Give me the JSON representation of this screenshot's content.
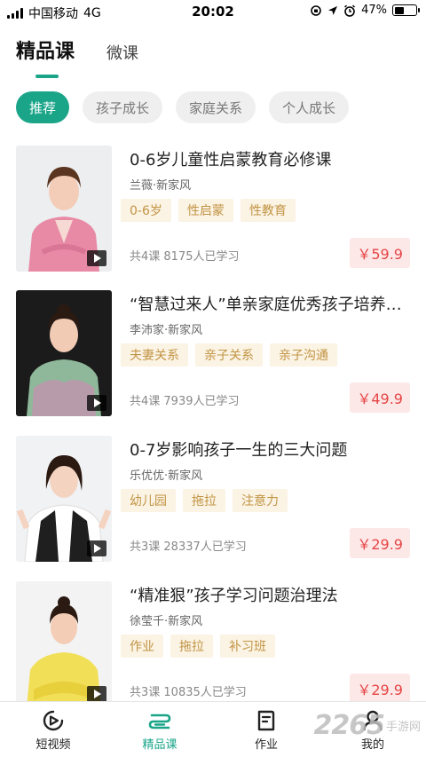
{
  "status_bar": {
    "carrier": "中国移动",
    "network": "4G",
    "time": "20:02",
    "battery": "47%",
    "battery_level": 0.47
  },
  "top_tabs": [
    {
      "label": "精品课",
      "active": true
    },
    {
      "label": "微课",
      "active": false
    }
  ],
  "categories": [
    {
      "label": "推荐",
      "active": true
    },
    {
      "label": "孩子成长",
      "active": false
    },
    {
      "label": "家庭关系",
      "active": false
    },
    {
      "label": "个人成长",
      "active": false
    }
  ],
  "courses": [
    {
      "title": "0-6岁儿童性启蒙教育必修课",
      "author": "兰薇·新家风",
      "tags": [
        "0-6岁",
        "性启蒙",
        "性教育"
      ],
      "meta": "共4课 8175人已学习",
      "price": "￥59.9"
    },
    {
      "title": "“智慧过来人”单亲家庭优秀孩子培养之道",
      "author": "李沛家·新家风",
      "tags": [
        "夫妻关系",
        "亲子关系",
        "亲子沟通"
      ],
      "meta": "共4课 7939人已学习",
      "price": "￥49.9"
    },
    {
      "title": "0-7岁影响孩子一生的三大问题",
      "author": "乐优优·新家风",
      "tags": [
        "幼儿园",
        "拖拉",
        "注意力"
      ],
      "meta": "共3课 28337人已学习",
      "price": "￥29.9"
    },
    {
      "title": "“精准狠”孩子学习问题治理法",
      "author": "徐莹千·新家风",
      "tags": [
        "作业",
        "拖拉",
        "补习班"
      ],
      "meta": "共3课 10835人已学习",
      "price": "￥29.9"
    }
  ],
  "bottom_nav": [
    {
      "label": "短视频",
      "icon": "short-video-icon",
      "active": false
    },
    {
      "label": "精品课",
      "icon": "course-icon",
      "active": true
    },
    {
      "label": "作业",
      "icon": "homework-icon",
      "active": false
    },
    {
      "label": "我的",
      "icon": "profile-icon",
      "active": false
    }
  ],
  "watermark": {
    "number": "2265",
    "text": "手游网"
  },
  "colors": {
    "accent": "#1aa589",
    "price": "#e64545",
    "tag_text": "#c29445",
    "tag_bg": "#fbf3e3"
  }
}
